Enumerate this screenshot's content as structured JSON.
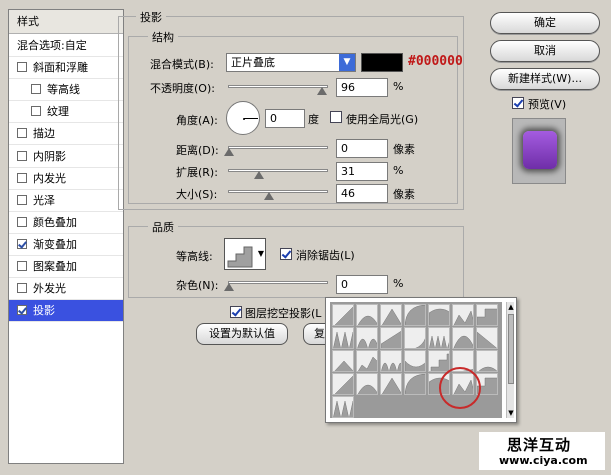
{
  "sidebar": {
    "title": "样式",
    "items": [
      {
        "label": "混合选项:自定",
        "checkbox": false,
        "checked": false
      },
      {
        "label": "斜面和浮雕",
        "checkbox": true,
        "checked": false
      },
      {
        "label": "等高线",
        "checkbox": true,
        "checked": false,
        "indent": true
      },
      {
        "label": "纹理",
        "checkbox": true,
        "checked": false,
        "indent": true
      },
      {
        "label": "描边",
        "checkbox": true,
        "checked": false
      },
      {
        "label": "内阴影",
        "checkbox": true,
        "checked": false
      },
      {
        "label": "内发光",
        "checkbox": true,
        "checked": false
      },
      {
        "label": "光泽",
        "checkbox": true,
        "checked": false
      },
      {
        "label": "颜色叠加",
        "checkbox": true,
        "checked": false
      },
      {
        "label": "渐变叠加",
        "checkbox": true,
        "checked": true
      },
      {
        "label": "图案叠加",
        "checkbox": true,
        "checked": false
      },
      {
        "label": "外发光",
        "checkbox": true,
        "checked": false
      },
      {
        "label": "投影",
        "checkbox": true,
        "checked": true,
        "selected": true
      }
    ]
  },
  "shadow": {
    "title": "投影",
    "structure_title": "结构",
    "blend_mode_label": "混合模式(B):",
    "blend_mode_value": "正片叠底",
    "color_hex_label": "#000000",
    "color": "#000000",
    "opacity_label": "不透明度(O):",
    "opacity_value": "96",
    "opacity_unit": "%",
    "angle_label": "角度(A):",
    "angle_value": "0",
    "angle_unit": "度",
    "global_light_label": "使用全局光(G)",
    "distance_label": "距离(D):",
    "distance_value": "0",
    "distance_unit": "像素",
    "spread_label": "扩展(R):",
    "spread_value": "31",
    "spread_unit": "%",
    "size_label": "大小(S):",
    "size_value": "46",
    "size_unit": "像素"
  },
  "quality": {
    "title": "品质",
    "contour_label": "等高线:",
    "antialias_label": "消除锯齿(L)",
    "noise_label": "杂色(N):",
    "noise_value": "0",
    "noise_unit": "%",
    "knockout_label": "图层挖空投影(L",
    "default_button": "设置为默认值",
    "reset_button_partial": "复"
  },
  "buttons": {
    "ok": "确定",
    "cancel": "取消",
    "new_style": "新建样式(W)...",
    "preview_label": "预览(V)"
  },
  "preview_color": "#8a3fc4",
  "accent_red": "#c01818",
  "watermark": {
    "name": "思洋互动",
    "url": "www.ciya.com"
  }
}
